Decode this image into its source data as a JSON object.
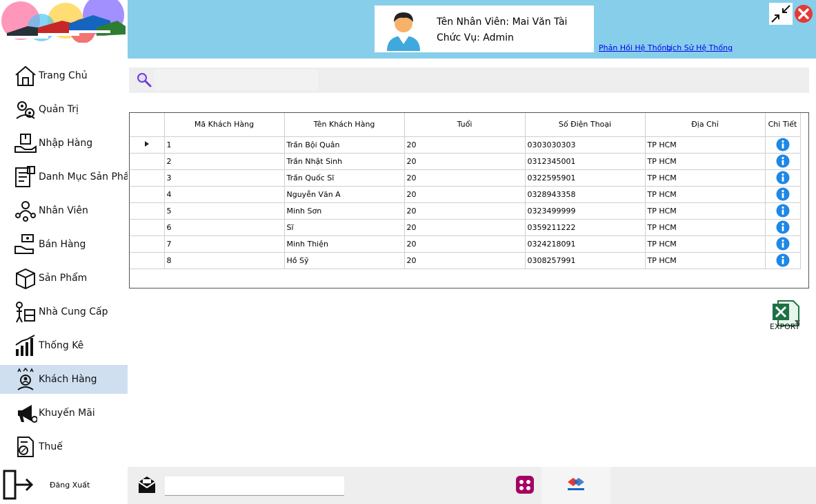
{
  "sidebar": {
    "items": [
      {
        "label": "Trang Chủ",
        "icon": "home-icon"
      },
      {
        "label": "Quản Trị",
        "icon": "admin-gear-icon"
      },
      {
        "label": "Nhập Hàng",
        "icon": "import-goods-icon"
      },
      {
        "label": "Danh Mục Sản Phẩm",
        "icon": "product-category-icon"
      },
      {
        "label": "Nhân Viên",
        "icon": "employees-icon"
      },
      {
        "label": "Bán Hàng",
        "icon": "sales-icon"
      },
      {
        "label": "Sản Phẩm",
        "icon": "product-box-icon"
      },
      {
        "label": "Nhà Cung Cấp",
        "icon": "supplier-icon"
      },
      {
        "label": "Thống Kê",
        "icon": "statistics-chart-icon"
      },
      {
        "label": "Khách Hàng",
        "icon": "customers-icon"
      },
      {
        "label": "Khuyến Mãi",
        "icon": "promotion-megaphone-icon"
      },
      {
        "label": "Thuế",
        "icon": "tax-document-icon"
      }
    ],
    "active_index": 9,
    "logout_label": "Đăng Xuất"
  },
  "header": {
    "user_name": "Tên Nhân Viên: Mai Văn Tài",
    "user_role": "Chức Vụ: Admin",
    "feedback_link": "Phản Hồi Hệ Thống",
    "history_link": "Lịch Sử Hệ Thống"
  },
  "search": {
    "value": ""
  },
  "table": {
    "columns": [
      "Mã Khách Hàng",
      "Tên Khách Hàng",
      "Tuổi",
      "Số Điện Thoại",
      "Địa Chỉ",
      "Chi Tiết"
    ],
    "rows": [
      [
        "1",
        "Trần Bội Quân",
        "20",
        "0303030303",
        "TP HCM"
      ],
      [
        "2",
        "Trần Nhật Sinh",
        "20",
        "0312345001",
        "TP HCM"
      ],
      [
        "3",
        "Trần Quốc Sĩ",
        "20",
        "0322595901",
        "TP HCM"
      ],
      [
        "4",
        "Nguyễn Văn A",
        "20",
        "0328943358",
        "TP HCM"
      ],
      [
        "5",
        "Minh Sơn",
        "20",
        "0323499999",
        "TP HCM"
      ],
      [
        "6",
        "Sĩ",
        "20",
        "0359211222",
        "TP HCM"
      ],
      [
        "7",
        "Minh Thiện",
        "20",
        "0324218091",
        "TP HCM"
      ],
      [
        "8",
        "Hồ Sỹ",
        "20",
        "0308257991",
        "TP HCM"
      ]
    ],
    "selected_row": 0
  },
  "export_label": "EXPORT",
  "footer": {
    "input_value": ""
  },
  "colors": {
    "header_bg": "#87ceeb",
    "active_nav": "#cfdff0",
    "info_blue": "#1e88e5",
    "close_red": "#e53935"
  }
}
